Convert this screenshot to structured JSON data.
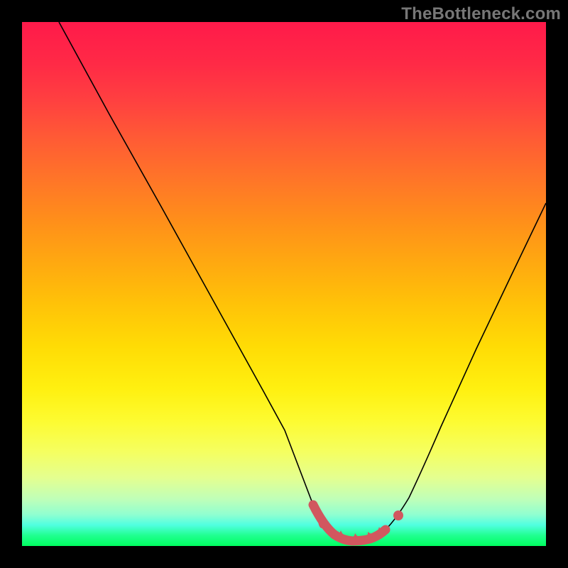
{
  "watermark": "TheBottleneck.com",
  "colors": {
    "frame": "#000000",
    "curve": "#000000",
    "highlight": "#d1575f"
  },
  "chart_data": {
    "type": "line",
    "title": "",
    "xlabel": "",
    "ylabel": "",
    "xlim": [
      0,
      100
    ],
    "ylim": [
      0,
      100
    ],
    "grid": false,
    "legend": false,
    "series": [
      {
        "name": "bottleneck-curve",
        "x": [
          7,
          10,
          15,
          20,
          25,
          30,
          35,
          40,
          45,
          50,
          52,
          54,
          56,
          58,
          60,
          62,
          64,
          66,
          68,
          70,
          75,
          80,
          85,
          90,
          95,
          100
        ],
        "y": [
          100,
          94,
          84,
          74,
          64,
          54,
          44,
          34,
          24,
          14,
          10,
          7,
          4.5,
          2.8,
          1.8,
          1.2,
          1.0,
          1.2,
          1.8,
          3.0,
          9,
          17,
          27,
          38,
          50,
          62
        ],
        "highlight_range_x": [
          55,
          72
        ]
      }
    ],
    "background_gradient": {
      "type": "vertical",
      "stops": [
        {
          "pos": 0.0,
          "color": "#ff1a4a"
        },
        {
          "pos": 0.5,
          "color": "#ffc308"
        },
        {
          "pos": 0.8,
          "color": "#f5ff60"
        },
        {
          "pos": 1.0,
          "color": "#00ff60"
        }
      ]
    }
  }
}
